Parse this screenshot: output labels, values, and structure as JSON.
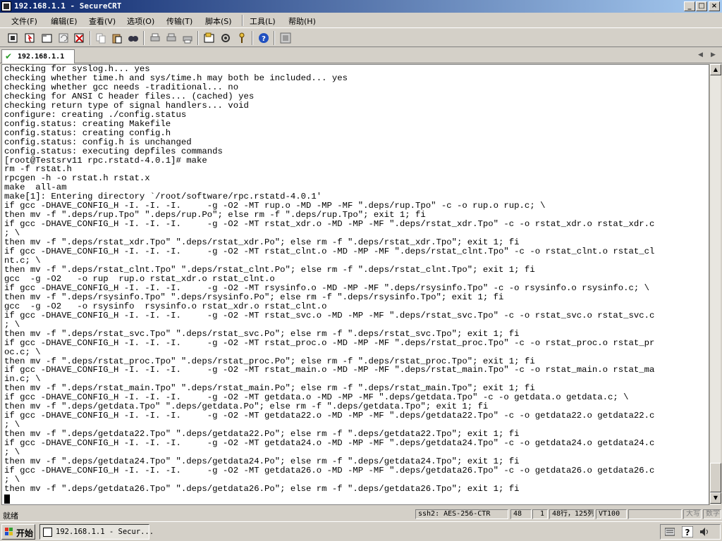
{
  "window": {
    "title": "192.168.1.1 - SecureCRT",
    "buttons": {
      "minimize": "_",
      "maximize": "□",
      "close": "×"
    }
  },
  "menu": [
    {
      "label": "文件(F)"
    },
    {
      "label": "编辑(E)"
    },
    {
      "label": "查看(V)"
    },
    {
      "label": "选项(O)"
    },
    {
      "label": "传输(T)"
    },
    {
      "label": "脚本(S)"
    },
    {
      "label": "工具(L)"
    },
    {
      "label": "帮助(H)"
    }
  ],
  "toolbar": {
    "icons": [
      "connect-icon",
      "quick-connect-icon",
      "connect-in-tab-icon",
      "reconnect-icon",
      "disconnect-icon",
      "copy-icon",
      "paste-icon",
      "find-icon",
      "print-icon",
      "print-selection-icon",
      "print-screen-icon",
      "session-options-icon",
      "global-options-icon",
      "key-icon",
      "help-icon",
      "about-icon"
    ]
  },
  "tabs": [
    {
      "label": "192.168.1.1",
      "status_icon": "check-icon",
      "status_color": "#2a9d2a"
    }
  ],
  "terminal": {
    "lines": [
      "checking for syslog.h... yes",
      "checking whether time.h and sys/time.h may both be included... yes",
      "checking whether gcc needs -traditional... no",
      "checking for ANSI C header files... (cached) yes",
      "checking return type of signal handlers... void",
      "configure: creating ./config.status",
      "config.status: creating Makefile",
      "config.status: creating config.h",
      "config.status: config.h is unchanged",
      "config.status: executing depfiles commands",
      "[root@Testsrv11 rpc.rstatd-4.0.1]# make",
      "rm -f rstat.h",
      "rpcgen -h -o rstat.h rstat.x",
      "make  all-am",
      "make[1]: Entering directory `/root/software/rpc.rstatd-4.0.1'",
      "if gcc -DHAVE_CONFIG_H -I. -I. -I.     -g -O2 -MT rup.o -MD -MP -MF \".deps/rup.Tpo\" -c -o rup.o rup.c; \\",
      "then mv -f \".deps/rup.Tpo\" \".deps/rup.Po\"; else rm -f \".deps/rup.Tpo\"; exit 1; fi",
      "if gcc -DHAVE_CONFIG_H -I. -I. -I.     -g -O2 -MT rstat_xdr.o -MD -MP -MF \".deps/rstat_xdr.Tpo\" -c -o rstat_xdr.o rstat_xdr.c",
      "; \\",
      "then mv -f \".deps/rstat_xdr.Tpo\" \".deps/rstat_xdr.Po\"; else rm -f \".deps/rstat_xdr.Tpo\"; exit 1; fi",
      "if gcc -DHAVE_CONFIG_H -I. -I. -I.     -g -O2 -MT rstat_clnt.o -MD -MP -MF \".deps/rstat_clnt.Tpo\" -c -o rstat_clnt.o rstat_cl",
      "nt.c; \\",
      "then mv -f \".deps/rstat_clnt.Tpo\" \".deps/rstat_clnt.Po\"; else rm -f \".deps/rstat_clnt.Tpo\"; exit 1; fi",
      "gcc  -g -O2   -o rup  rup.o rstat_xdr.o rstat_clnt.o",
      "if gcc -DHAVE_CONFIG_H -I. -I. -I.     -g -O2 -MT rsysinfo.o -MD -MP -MF \".deps/rsysinfo.Tpo\" -c -o rsysinfo.o rsysinfo.c; \\",
      "then mv -f \".deps/rsysinfo.Tpo\" \".deps/rsysinfo.Po\"; else rm -f \".deps/rsysinfo.Tpo\"; exit 1; fi",
      "gcc  -g -O2   -o rsysinfo  rsysinfo.o rstat_xdr.o rstat_clnt.o",
      "if gcc -DHAVE_CONFIG_H -I. -I. -I.     -g -O2 -MT rstat_svc.o -MD -MP -MF \".deps/rstat_svc.Tpo\" -c -o rstat_svc.o rstat_svc.c",
      "; \\",
      "then mv -f \".deps/rstat_svc.Tpo\" \".deps/rstat_svc.Po\"; else rm -f \".deps/rstat_svc.Tpo\"; exit 1; fi",
      "if gcc -DHAVE_CONFIG_H -I. -I. -I.     -g -O2 -MT rstat_proc.o -MD -MP -MF \".deps/rstat_proc.Tpo\" -c -o rstat_proc.o rstat_pr",
      "oc.c; \\",
      "then mv -f \".deps/rstat_proc.Tpo\" \".deps/rstat_proc.Po\"; else rm -f \".deps/rstat_proc.Tpo\"; exit 1; fi",
      "if gcc -DHAVE_CONFIG_H -I. -I. -I.     -g -O2 -MT rstat_main.o -MD -MP -MF \".deps/rstat_main.Tpo\" -c -o rstat_main.o rstat_ma",
      "in.c; \\",
      "then mv -f \".deps/rstat_main.Tpo\" \".deps/rstat_main.Po\"; else rm -f \".deps/rstat_main.Tpo\"; exit 1; fi",
      "if gcc -DHAVE_CONFIG_H -I. -I. -I.     -g -O2 -MT getdata.o -MD -MP -MF \".deps/getdata.Tpo\" -c -o getdata.o getdata.c; \\",
      "then mv -f \".deps/getdata.Tpo\" \".deps/getdata.Po\"; else rm -f \".deps/getdata.Tpo\"; exit 1; fi",
      "if gcc -DHAVE_CONFIG_H -I. -I. -I.     -g -O2 -MT getdata22.o -MD -MP -MF \".deps/getdata22.Tpo\" -c -o getdata22.o getdata22.c",
      "; \\",
      "then mv -f \".deps/getdata22.Tpo\" \".deps/getdata22.Po\"; else rm -f \".deps/getdata22.Tpo\"; exit 1; fi",
      "if gcc -DHAVE_CONFIG_H -I. -I. -I.     -g -O2 -MT getdata24.o -MD -MP -MF \".deps/getdata24.Tpo\" -c -o getdata24.o getdata24.c",
      "; \\",
      "then mv -f \".deps/getdata24.Tpo\" \".deps/getdata24.Po\"; else rm -f \".deps/getdata24.Tpo\"; exit 1; fi",
      "if gcc -DHAVE_CONFIG_H -I. -I. -I.     -g -O2 -MT getdata26.o -MD -MP -MF \".deps/getdata26.Tpo\" -c -o getdata26.o getdata26.c",
      "; \\",
      "then mv -f \".deps/getdata26.Tpo\" \".deps/getdata26.Po\"; else rm -f \".deps/getdata26.Tpo\"; exit 1; fi"
    ]
  },
  "statusbar": {
    "ready": "就绪",
    "cipher": "ssh2: AES-256-CTR",
    "row": "48",
    "col": "1",
    "size": "48行，125列",
    "term": "VT100",
    "blank": "",
    "caps": "大写",
    "num": "数字"
  },
  "taskbar": {
    "start_label": "开始",
    "task_label": "192.168.1.1 - Secur..."
  }
}
